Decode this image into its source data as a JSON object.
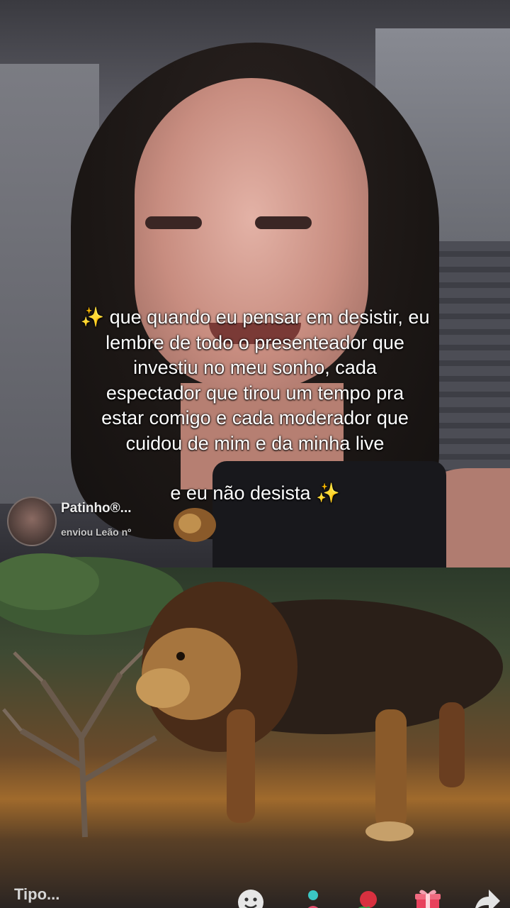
{
  "overlay": {
    "lines": [
      "✨ que quando eu pensar em desistir, eu",
      "lembre de todo o presenteador que",
      "investiu no meu sonho, cada",
      "espectador que tirou um tempo pra",
      "estar comigo e cada moderador que",
      "cuidou de mim e da minha live"
    ],
    "closing": "e eu não desista ✨"
  },
  "gift_banner": {
    "username": "Patinho®...",
    "message": "enviou Leão nº"
  },
  "bottom_bar": {
    "comment_placeholder": "Tipo..."
  },
  "icons": {
    "emoji": "emoji-icon",
    "share_user": "invite-icon",
    "rose": "rose-gift-icon",
    "gift": "gift-icon",
    "share": "share-icon"
  },
  "colors": {
    "overlay_text": "#ffffff",
    "gift_accent": "#e8415c",
    "share_accent": "#d84a5a"
  }
}
